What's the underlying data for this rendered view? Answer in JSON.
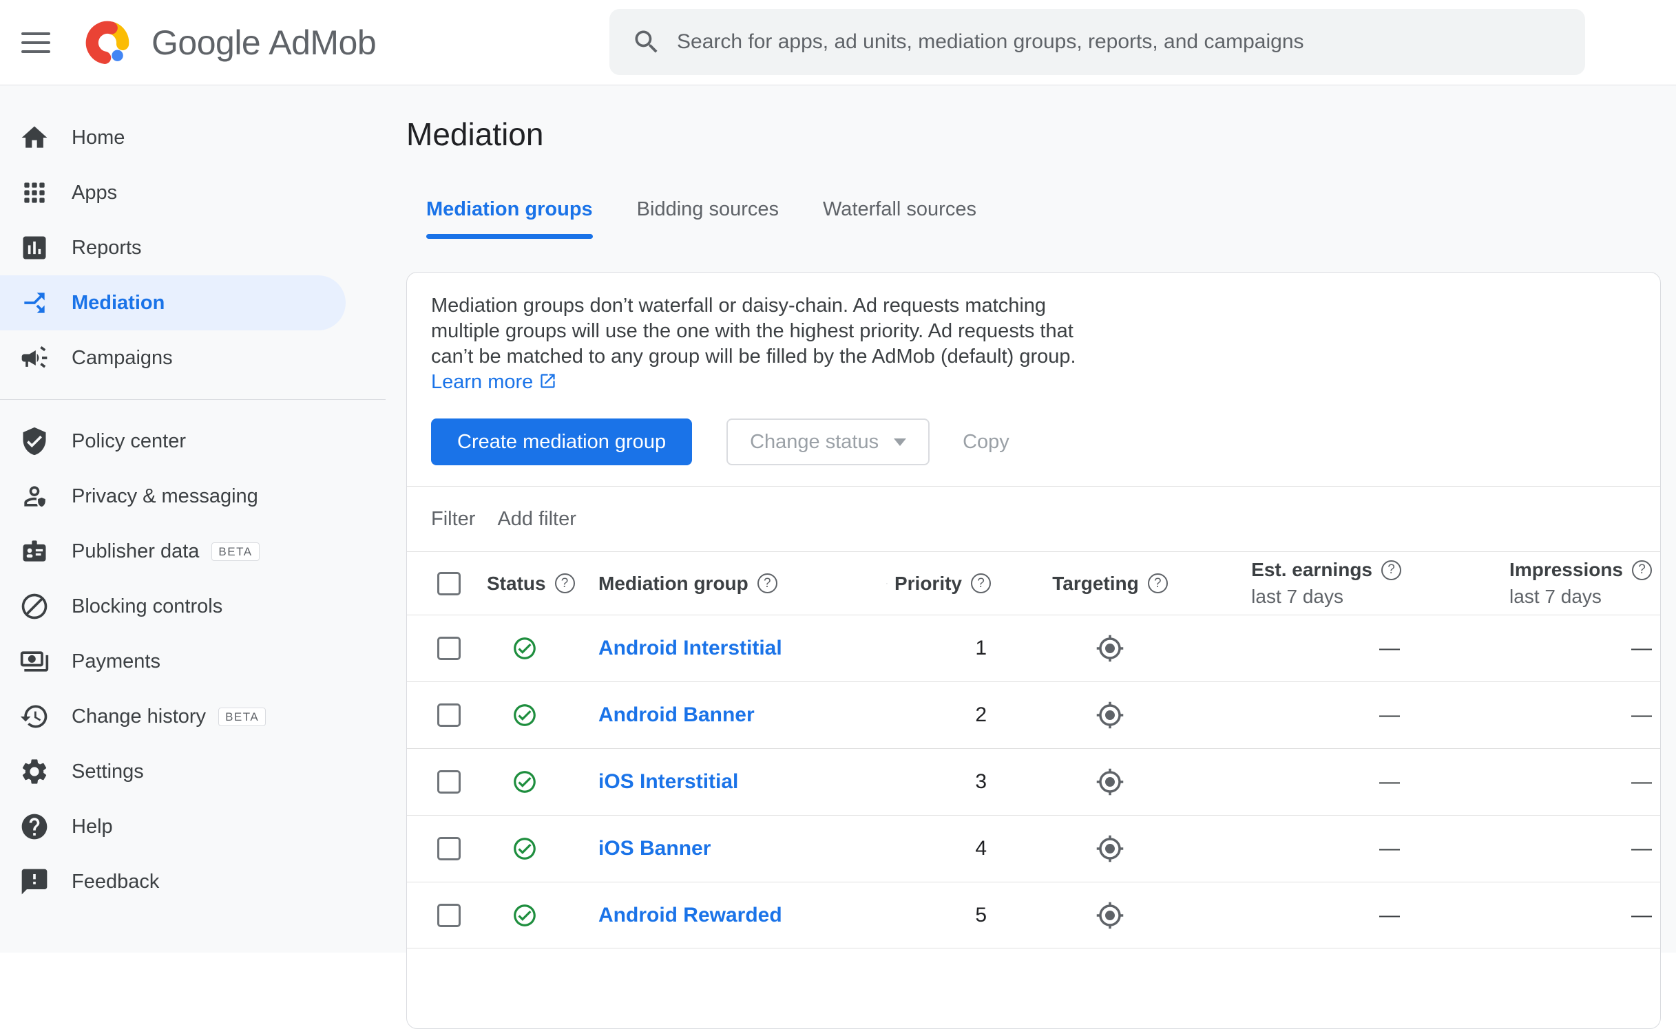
{
  "colors": {
    "accent": "#1a73e8",
    "accent_bg": "#e8f0fe",
    "status_green": "#1e8e3e",
    "logo_red": "#ea4335",
    "logo_yellow": "#fbbc04",
    "logo_blue": "#4285f4"
  },
  "header": {
    "brand_primary": "Google",
    "brand_secondary": "AdMob",
    "search_placeholder": "Search for apps, ad units, mediation groups, reports, and campaigns"
  },
  "sidebar": {
    "items": [
      {
        "label": "Home"
      },
      {
        "label": "Apps"
      },
      {
        "label": "Reports"
      },
      {
        "label": "Mediation",
        "active": true
      },
      {
        "label": "Campaigns"
      },
      {
        "label": "Policy center"
      },
      {
        "label": "Privacy & messaging"
      },
      {
        "label": "Publisher data",
        "badge": "BETA"
      },
      {
        "label": "Blocking controls"
      },
      {
        "label": "Payments"
      },
      {
        "label": "Change history",
        "badge": "BETA"
      },
      {
        "label": "Settings"
      },
      {
        "label": "Help"
      },
      {
        "label": "Feedback"
      }
    ]
  },
  "page": {
    "title": "Mediation"
  },
  "tabs": [
    {
      "label": "Mediation groups",
      "active": true
    },
    {
      "label": "Bidding sources"
    },
    {
      "label": "Waterfall sources"
    }
  ],
  "card": {
    "description": "Mediation groups don’t waterfall or daisy-chain. Ad requests matching multiple groups will use the one with the highest priority. Ad requests that can’t be matched to any group will be filled by the AdMob (default) group.",
    "learn_more": "Learn more",
    "create_button": "Create mediation group",
    "change_status_button": "Change status",
    "copy_button": "Copy",
    "filter_label": "Filter",
    "add_filter": "Add filter"
  },
  "table": {
    "columns": {
      "status": "Status",
      "group": "Mediation group",
      "priority": "Priority",
      "targeting": "Targeting",
      "earnings": "Est. earnings",
      "impressions": "Impressions",
      "period": "last 7 days"
    },
    "rows": [
      {
        "name": "Android Interstitial",
        "priority": "1",
        "earnings": "—",
        "impressions": "—"
      },
      {
        "name": "Android Banner",
        "priority": "2",
        "earnings": "—",
        "impressions": "—"
      },
      {
        "name": "iOS Interstitial",
        "priority": "3",
        "earnings": "—",
        "impressions": "—"
      },
      {
        "name": "iOS Banner",
        "priority": "4",
        "earnings": "—",
        "impressions": "—"
      },
      {
        "name": "Android Rewarded",
        "priority": "5",
        "earnings": "—",
        "impressions": "—"
      }
    ]
  }
}
